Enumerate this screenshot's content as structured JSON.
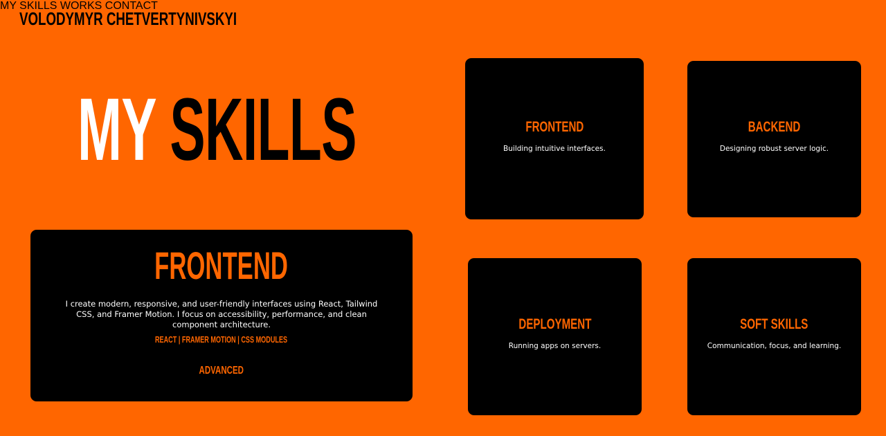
{
  "header": {
    "brand": "VOLODYMYR CHETVERTYNIVSKYI",
    "nav": [
      {
        "label": "MY SKILLS"
      },
      {
        "label": "WORKS"
      },
      {
        "label": "CONTACT"
      }
    ]
  },
  "hero": {
    "word1": "MY",
    "word2": "SKILLS"
  },
  "detail": {
    "title": "FRONTEND",
    "description": "I create modern, responsive, and user-friendly interfaces using React, Tailwind CSS, and Framer Motion. I focus on accessibility, performance, and clean component architecture.",
    "tags": "REACT | FRAMER MOTION | CSS MODULES",
    "level": "ADVANCED"
  },
  "cards": [
    {
      "title": "FRONTEND",
      "desc": "Building intuitive interfaces."
    },
    {
      "title": "BACKEND",
      "desc": "Designing robust server logic."
    },
    {
      "title": "DEPLOYMENT",
      "desc": "Running apps on servers."
    },
    {
      "title": "SOFT SKILLS",
      "desc": "Communication, focus, and learning."
    }
  ],
  "colors": {
    "background": "#ff6600",
    "card": "#000000",
    "accent": "#ff6600",
    "text_light": "#ffffff"
  }
}
